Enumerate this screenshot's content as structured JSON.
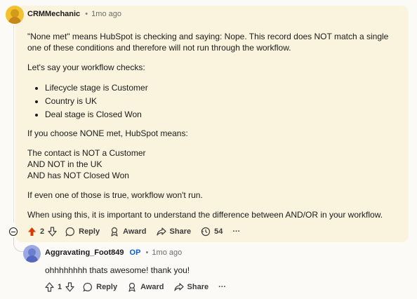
{
  "comment": {
    "username": "CRMMechanic",
    "separator": "•",
    "time": "1mo ago",
    "paragraphs": {
      "p1": "\"None met\" means HubSpot is checking and saying: Nope. This record does NOT match a single one of these conditions and therefore will not run through the workflow.",
      "p2": "Let's say your workflow checks:",
      "p3": "If you choose NONE met, HubSpot means:",
      "p4_line1": "The contact is NOT a Customer",
      "p4_line2": "AND NOT in the UK",
      "p4_line3": "AND has NOT Closed Won",
      "p5": "If even one of those is true, workflow won't run.",
      "p6": "When using this, it is important to understand the difference between AND/OR in your workflow."
    },
    "conditions": [
      "Lifecycle stage is Customer",
      "Country is UK",
      "Deal stage is Closed Won"
    ],
    "actions": {
      "votes": "2",
      "reply": "Reply",
      "award": "Award",
      "share": "Share",
      "views": "54",
      "more": "···"
    },
    "colors": {
      "upvote_active": "#d93a00",
      "highlight": "#faf3dd"
    }
  },
  "reply": {
    "username": "Aggravating_Foot849",
    "op_badge": "OP",
    "separator": "•",
    "time": "1mo ago",
    "text": "ohhhhhhhh thats awesome! thank you!",
    "actions": {
      "votes": "1",
      "reply": "Reply",
      "award": "Award",
      "share": "Share",
      "more": "···"
    },
    "colors": {
      "op": "#0a5fd4"
    }
  }
}
